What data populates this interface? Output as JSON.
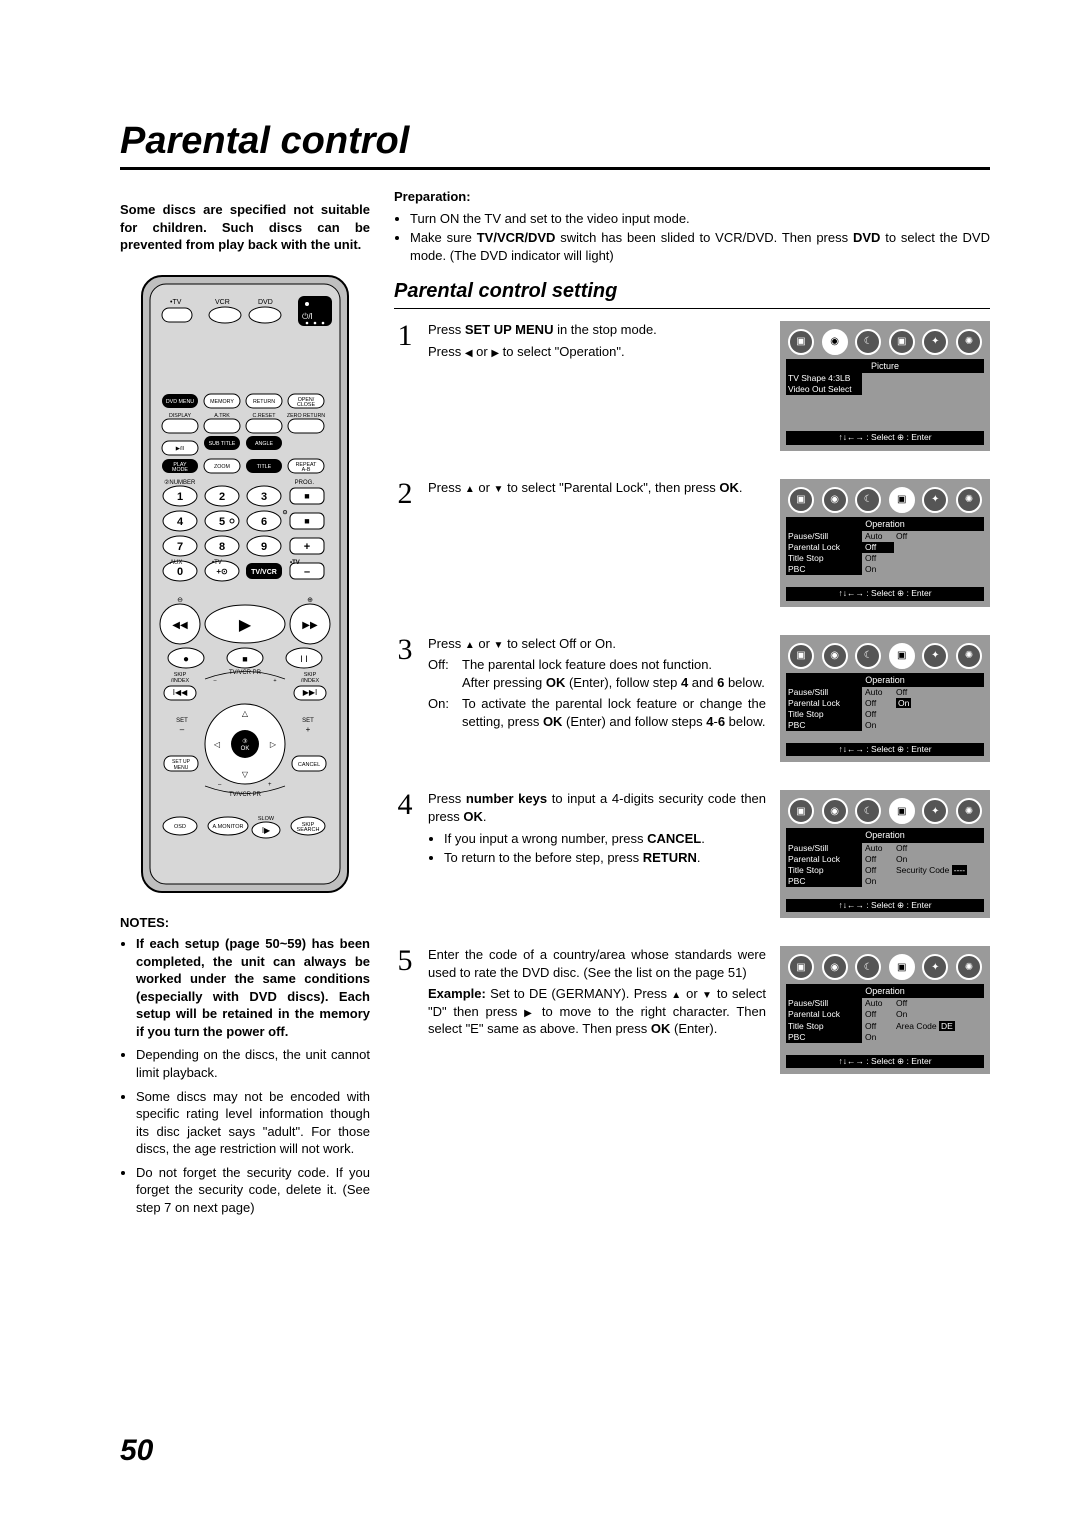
{
  "title": "Parental control",
  "intro": "Some discs are specified not suitable for children. Such discs can be prevented from play back with the unit.",
  "notes_heading": "NOTES:",
  "notes": [
    "If each setup (page 50~59) has been completed, the unit can always be worked under the same conditions (especially with DVD discs). Each setup will be retained in the memory if you turn the power off.",
    "Depending on the discs, the unit cannot limit playback.",
    "Some discs may not be encoded with specific rating level information though its disc jacket says \"adult\". For those discs, the age restriction will not work.",
    "Do not forget the security code. If you forget the security code, delete it. (See step 7 on next page)"
  ],
  "notes_bold_first": true,
  "preparation_heading": "Preparation:",
  "preparation": [
    "Turn ON the TV and set to the video input mode.",
    "Make sure TV/VCR/DVD switch has been slided to VCR/DVD. Then press DVD to select the DVD mode. (The DVD indicator will light)"
  ],
  "subheading": "Parental control setting",
  "steps": [
    {
      "num": "1",
      "text_main": "Press SET UP MENU in the stop mode.",
      "text_sub": "Press ◀ or ▶ to select \"Operation\"."
    },
    {
      "num": "2",
      "text_main": "Press ▲ or ▼ to select \"Parental Lock\", then press OK."
    },
    {
      "num": "3",
      "text_main": "Press ▲ or ▼ to select Off or On.",
      "off_label": "Off:",
      "off_text": "The parental lock feature does not function. After pressing OK (Enter), follow step 4 and 6 below.",
      "on_label": "On:",
      "on_text": "To activate the parental lock feature or change the setting, press OK (Enter) and follow steps 4-6 below."
    },
    {
      "num": "4",
      "text_main": "Press number keys to input a 4-digits security code then press OK.",
      "bullets": [
        "If you input a wrong number, press CANCEL.",
        "To return to the before step, press RETURN."
      ]
    },
    {
      "num": "5",
      "text_main": "Enter the code of a country/area whose standards were used to rate the DVD disc. (See the list on the page 51)",
      "example_label": "Example:",
      "example_text": "Set to DE (GERMANY). Press ▲ or ▼ to select \"D\" then press ▶ to move to the right character. Then select \"E\" same as above. Then press OK (Enter)."
    }
  ],
  "menus": {
    "m1": {
      "icon_active": 1,
      "section": "Picture",
      "rows": [
        {
          "label": "TV Shape 4:3LB",
          "val": "",
          "inv": false
        },
        {
          "label": "Video Out Select",
          "val": "",
          "inv": false
        }
      ],
      "footer": "↑↓←→ : Select   ⊕ : Enter",
      "tall": true
    },
    "m2": {
      "icon_active": 3,
      "section": "Operation",
      "rows": [
        {
          "label": "Pause/Still",
          "val": "Auto",
          "extra": "Off"
        },
        {
          "label": "Parental Lock",
          "val": "Off",
          "inv": true
        },
        {
          "label": "Title Stop",
          "val": "Off"
        },
        {
          "label": "PBC",
          "val": "On"
        }
      ],
      "footer": "↑↓←→ : Select   ⊕ : Enter"
    },
    "m3": {
      "icon_active": 3,
      "section": "Operation",
      "rows": [
        {
          "label": "Pause/Still",
          "val": "Auto",
          "extra": "Off"
        },
        {
          "label": "Parental Lock",
          "val": "Off",
          "extra": "On",
          "extra_inv": true
        },
        {
          "label": "Title Stop",
          "val": "Off"
        },
        {
          "label": "PBC",
          "val": "On"
        }
      ],
      "footer": "↑↓←→ : Select   ⊕ : Enter"
    },
    "m4": {
      "icon_active": 3,
      "section": "Operation",
      "rows": [
        {
          "label": "Pause/Still",
          "val": "Auto",
          "extra": "Off"
        },
        {
          "label": "Parental Lock",
          "val": "Off",
          "extra": "On"
        },
        {
          "label": "Title Stop",
          "val": "Off",
          "extra_label": "Security Code",
          "extra_val": "----"
        },
        {
          "label": "PBC",
          "val": "On"
        }
      ],
      "footer": "↑↓←→ : Select   ⊕ : Enter"
    },
    "m5": {
      "icon_active": 3,
      "section": "Operation",
      "rows": [
        {
          "label": "Pause/Still",
          "val": "Auto",
          "extra": "Off"
        },
        {
          "label": "Parental Lock",
          "val": "Off",
          "extra": "On"
        },
        {
          "label": "Title Stop",
          "val": "Off",
          "extra_label": "Area Code",
          "extra_val": "DE",
          "extra_val_inv": true
        },
        {
          "label": "PBC",
          "val": "On"
        }
      ],
      "footer": "↑↓←→ : Select   ⊕ : Enter"
    }
  },
  "remote": {
    "top_labels": [
      "•TV",
      "VCR",
      "DVD"
    ],
    "power_icon": "⏻/I",
    "row_labels_1": [
      "DVD MENU",
      "MEMORY",
      "RETURN",
      "OPEN/\nCLOSE"
    ],
    "row_labels_2": [
      "DISPLAY",
      "A.TRK",
      "C.RESET",
      "ZERO RETURN"
    ],
    "row_labels_3": [
      "▶/II",
      "SUB TITLE",
      "ANGLE",
      ""
    ],
    "row_labels_4": [
      "PLAY MODE",
      "ZOOM",
      "TITLE",
      "REPEAT A-B"
    ],
    "number_label": "②NUMBER",
    "prog_label": "PROG.",
    "numbers": [
      "1",
      "2",
      "3",
      "4",
      "5",
      "6",
      "7",
      "8",
      "9",
      "0"
    ],
    "aux_label": "AUX",
    "tv_label": "•TV",
    "tvvcr_label": "TV/VCR",
    "plus": "+",
    "minus": "–",
    "skip_label": "SKIP/INDEX",
    "tvvcr_pr": "TV/VCR PR",
    "set_label": "SET",
    "ok_label": "OK",
    "setup_menu": "SET UP MENU",
    "cancel": "CANCEL",
    "osd": "OSD",
    "amonitor": "A.MONITOR",
    "slow": "SLOW",
    "skip_search": "SKIP SEARCH",
    "rec": "●",
    "stop": "■",
    "pause": "II",
    "play": "▶",
    "rew": "◀◀",
    "ff": "▶▶",
    "prev": "I◀◀",
    "next": "▶▶I"
  },
  "page_number": "50"
}
